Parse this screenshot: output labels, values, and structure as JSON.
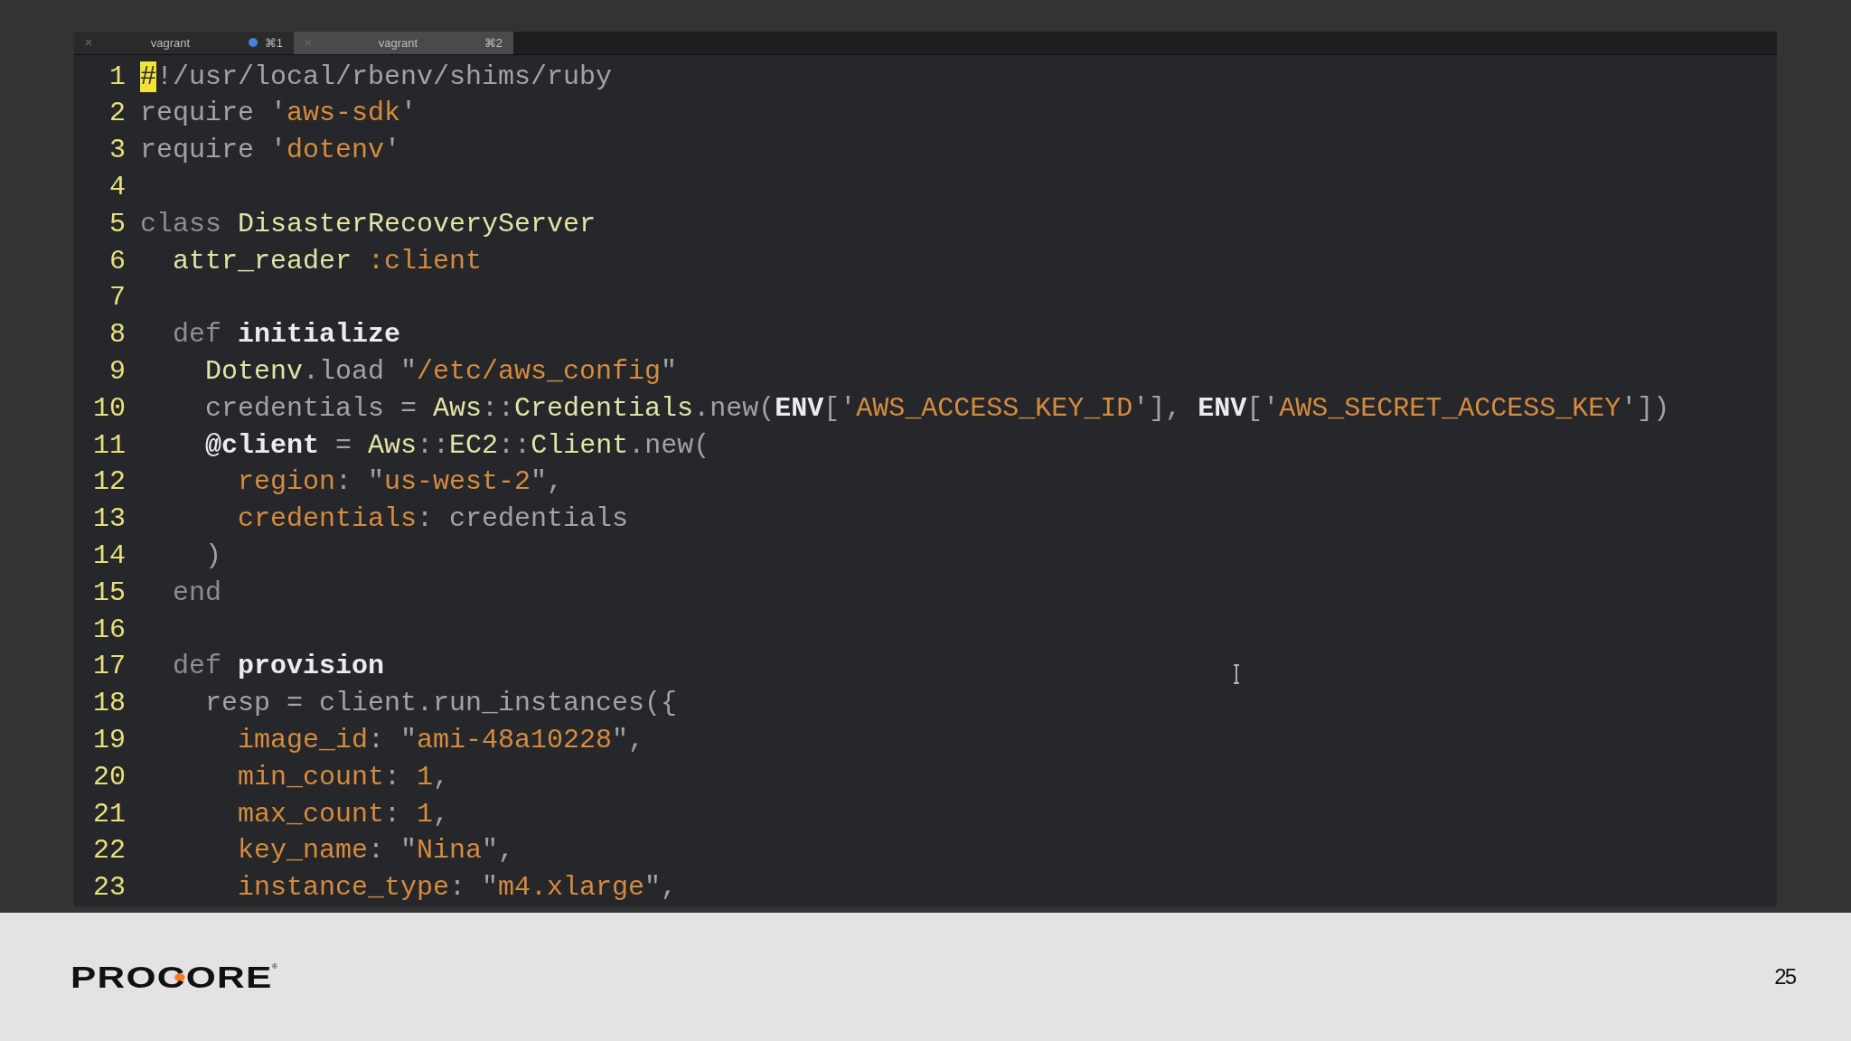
{
  "tabs": [
    {
      "label": "vagrant",
      "shortcut": "⌘1",
      "selected": false,
      "activity": true
    },
    {
      "label": "vagrant",
      "shortcut": "⌘2",
      "selected": true,
      "activity": false
    }
  ],
  "editor": {
    "lines": [
      {
        "number": "1",
        "tokens": [
          {
            "kind": "cursor",
            "text": "#"
          },
          {
            "kind": "plain",
            "text": "!/usr/local/rbenv/shims/ruby"
          }
        ]
      },
      {
        "number": "2",
        "tokens": [
          {
            "kind": "plain",
            "text": "require '"
          },
          {
            "kind": "string",
            "text": "aws-sdk"
          },
          {
            "kind": "plain",
            "text": "'"
          }
        ]
      },
      {
        "number": "3",
        "tokens": [
          {
            "kind": "plain",
            "text": "require '"
          },
          {
            "kind": "string",
            "text": "dotenv"
          },
          {
            "kind": "plain",
            "text": "'"
          }
        ]
      },
      {
        "number": "4"
      },
      {
        "number": "5",
        "tokens": [
          {
            "kind": "keyword",
            "text": "class "
          },
          {
            "kind": "const",
            "text": "DisasterRecoveryServer"
          }
        ]
      },
      {
        "number": "6",
        "tokens": [
          {
            "kind": "const",
            "text": "  attr_reader "
          },
          {
            "kind": "string",
            "text": ":client"
          }
        ]
      },
      {
        "number": "7"
      },
      {
        "number": "8",
        "tokens": [
          {
            "kind": "keyword",
            "text": "  def "
          },
          {
            "kind": "method",
            "text": "initialize"
          }
        ]
      },
      {
        "number": "9",
        "tokens": [
          {
            "kind": "const",
            "text": "    Dotenv"
          },
          {
            "kind": "plain",
            "text": ".load \""
          },
          {
            "kind": "string",
            "text": "/etc/aws_config"
          },
          {
            "kind": "plain",
            "text": "\""
          }
        ]
      },
      {
        "number": "10",
        "tokens": [
          {
            "kind": "plain",
            "text": "    credentials = "
          },
          {
            "kind": "const",
            "text": "Aws"
          },
          {
            "kind": "plain",
            "text": "::"
          },
          {
            "kind": "const",
            "text": "Credentials"
          },
          {
            "kind": "plain",
            "text": ".new("
          },
          {
            "kind": "method",
            "text": "ENV"
          },
          {
            "kind": "plain",
            "text": "['"
          },
          {
            "kind": "string",
            "text": "AWS_ACCESS_KEY_ID"
          },
          {
            "kind": "plain",
            "text": "'], "
          },
          {
            "kind": "method",
            "text": "ENV"
          },
          {
            "kind": "plain",
            "text": "['"
          },
          {
            "kind": "string",
            "text": "AWS_SECRET_ACCESS_KEY"
          },
          {
            "kind": "plain",
            "text": "'])"
          }
        ]
      },
      {
        "number": "11",
        "tokens": [
          {
            "kind": "method",
            "text": "    @client"
          },
          {
            "kind": "plain",
            "text": " = "
          },
          {
            "kind": "const",
            "text": "Aws"
          },
          {
            "kind": "plain",
            "text": "::"
          },
          {
            "kind": "const",
            "text": "EC2"
          },
          {
            "kind": "plain",
            "text": "::"
          },
          {
            "kind": "const",
            "text": "Client"
          },
          {
            "kind": "plain",
            "text": ".new("
          }
        ]
      },
      {
        "number": "12",
        "tokens": [
          {
            "kind": "string",
            "text": "      region"
          },
          {
            "kind": "plain",
            "text": ": \""
          },
          {
            "kind": "string",
            "text": "us-west-2"
          },
          {
            "kind": "plain",
            "text": "\","
          }
        ]
      },
      {
        "number": "13",
        "tokens": [
          {
            "kind": "string",
            "text": "      credentials"
          },
          {
            "kind": "plain",
            "text": ": credentials"
          }
        ]
      },
      {
        "number": "14",
        "tokens": [
          {
            "kind": "plain",
            "text": "    )"
          }
        ]
      },
      {
        "number": "15",
        "tokens": [
          {
            "kind": "keyword",
            "text": "  end"
          }
        ]
      },
      {
        "number": "16"
      },
      {
        "number": "17",
        "tokens": [
          {
            "kind": "keyword",
            "text": "  def "
          },
          {
            "kind": "method",
            "text": "provision"
          }
        ]
      },
      {
        "number": "18",
        "tokens": [
          {
            "kind": "plain",
            "text": "    resp = client.run_instances({"
          }
        ]
      },
      {
        "number": "19",
        "tokens": [
          {
            "kind": "string",
            "text": "      image_id"
          },
          {
            "kind": "plain",
            "text": ": \""
          },
          {
            "kind": "string",
            "text": "ami-48a10228"
          },
          {
            "kind": "plain",
            "text": "\","
          }
        ]
      },
      {
        "number": "20",
        "tokens": [
          {
            "kind": "string",
            "text": "      min_count"
          },
          {
            "kind": "plain",
            "text": ": "
          },
          {
            "kind": "string",
            "text": "1"
          },
          {
            "kind": "plain",
            "text": ","
          }
        ]
      },
      {
        "number": "21",
        "tokens": [
          {
            "kind": "string",
            "text": "      max_count"
          },
          {
            "kind": "plain",
            "text": ": "
          },
          {
            "kind": "string",
            "text": "1"
          },
          {
            "kind": "plain",
            "text": ","
          }
        ]
      },
      {
        "number": "22",
        "tokens": [
          {
            "kind": "string",
            "text": "      key_name"
          },
          {
            "kind": "plain",
            "text": ": \""
          },
          {
            "kind": "string",
            "text": "Nina"
          },
          {
            "kind": "plain",
            "text": "\","
          }
        ]
      },
      {
        "number": "23",
        "tokens": [
          {
            "kind": "string",
            "text": "      instance_type"
          },
          {
            "kind": "plain",
            "text": ": \""
          },
          {
            "kind": "string",
            "text": "m4.xlarge"
          },
          {
            "kind": "plain",
            "text": "\","
          }
        ]
      }
    ]
  },
  "footer": {
    "logo": "PROCORE",
    "logo_mark": "®",
    "page_number": "25"
  }
}
